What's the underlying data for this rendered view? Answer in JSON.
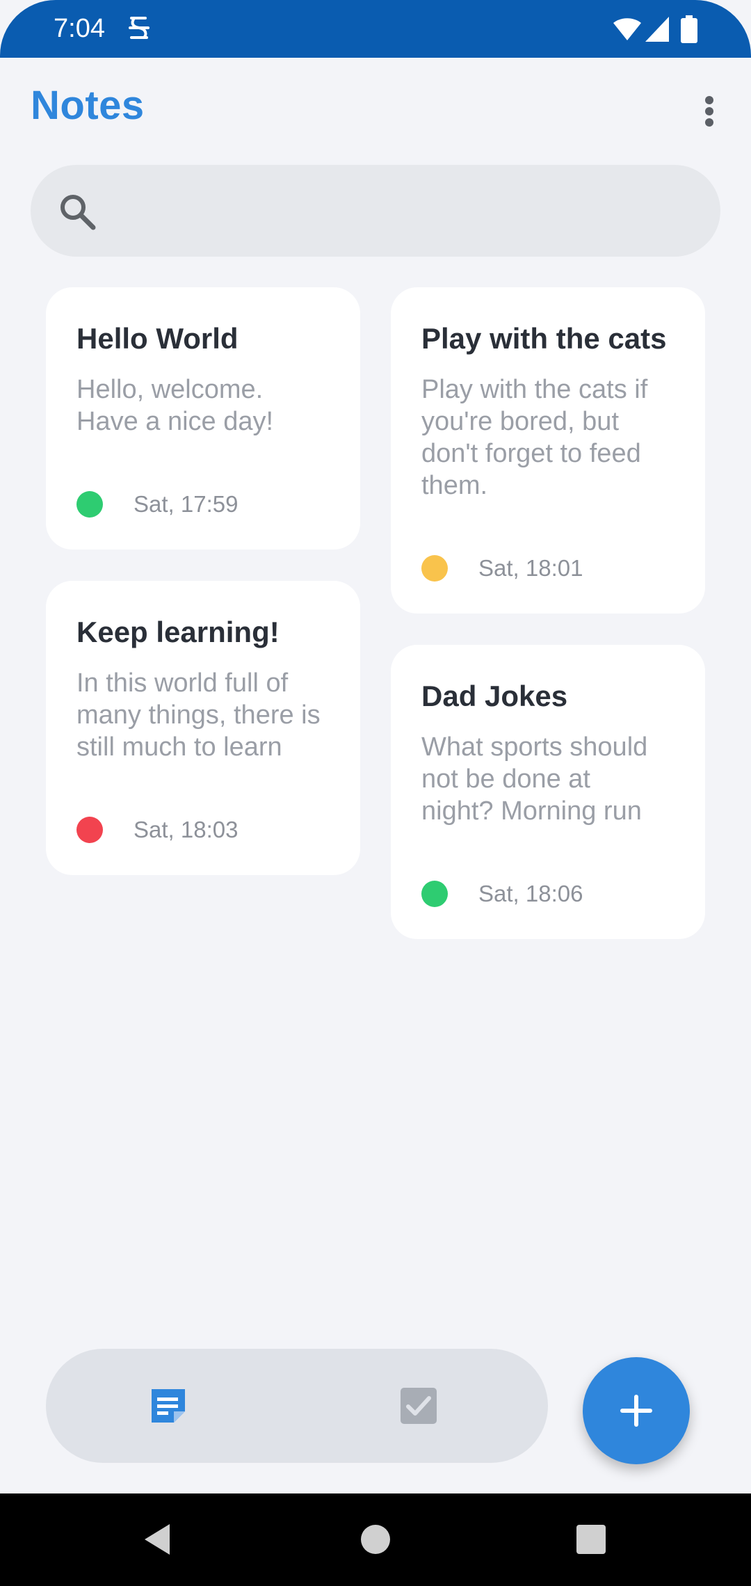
{
  "status_bar": {
    "time": "7:04"
  },
  "header": {
    "title": "Notes",
    "menu_icon": "more-vert-icon"
  },
  "search": {
    "placeholder": "",
    "value": ""
  },
  "notes": [
    {
      "title": "Hello World",
      "body": "Hello, welcome. Have a nice day!",
      "date": "Sat, 17:59",
      "color": "#2ecc71"
    },
    {
      "title": "Play with the cats",
      "body": "Play with the cats if you're bored, but don't forget to feed them.",
      "date": "Sat, 18:01",
      "color": "#f9c34c"
    },
    {
      "title": "Keep learning!",
      "body": "In this world full of many things, there is still much to learn",
      "date": "Sat, 18:03",
      "color": "#f2434f"
    },
    {
      "title": "Dad Jokes",
      "body": "What sports should not be done at night? Morning run",
      "date": "Sat, 18:06",
      "color": "#2ecc71"
    }
  ],
  "bottom_nav": {
    "items": [
      {
        "icon": "notes-icon",
        "active": true
      },
      {
        "icon": "checkbox-icon",
        "active": false
      }
    ],
    "fab_icon": "plus-icon"
  },
  "colors": {
    "accent": "#2f86dc",
    "status_bar": "#0a5cb0",
    "background": "#f3f4f8"
  }
}
